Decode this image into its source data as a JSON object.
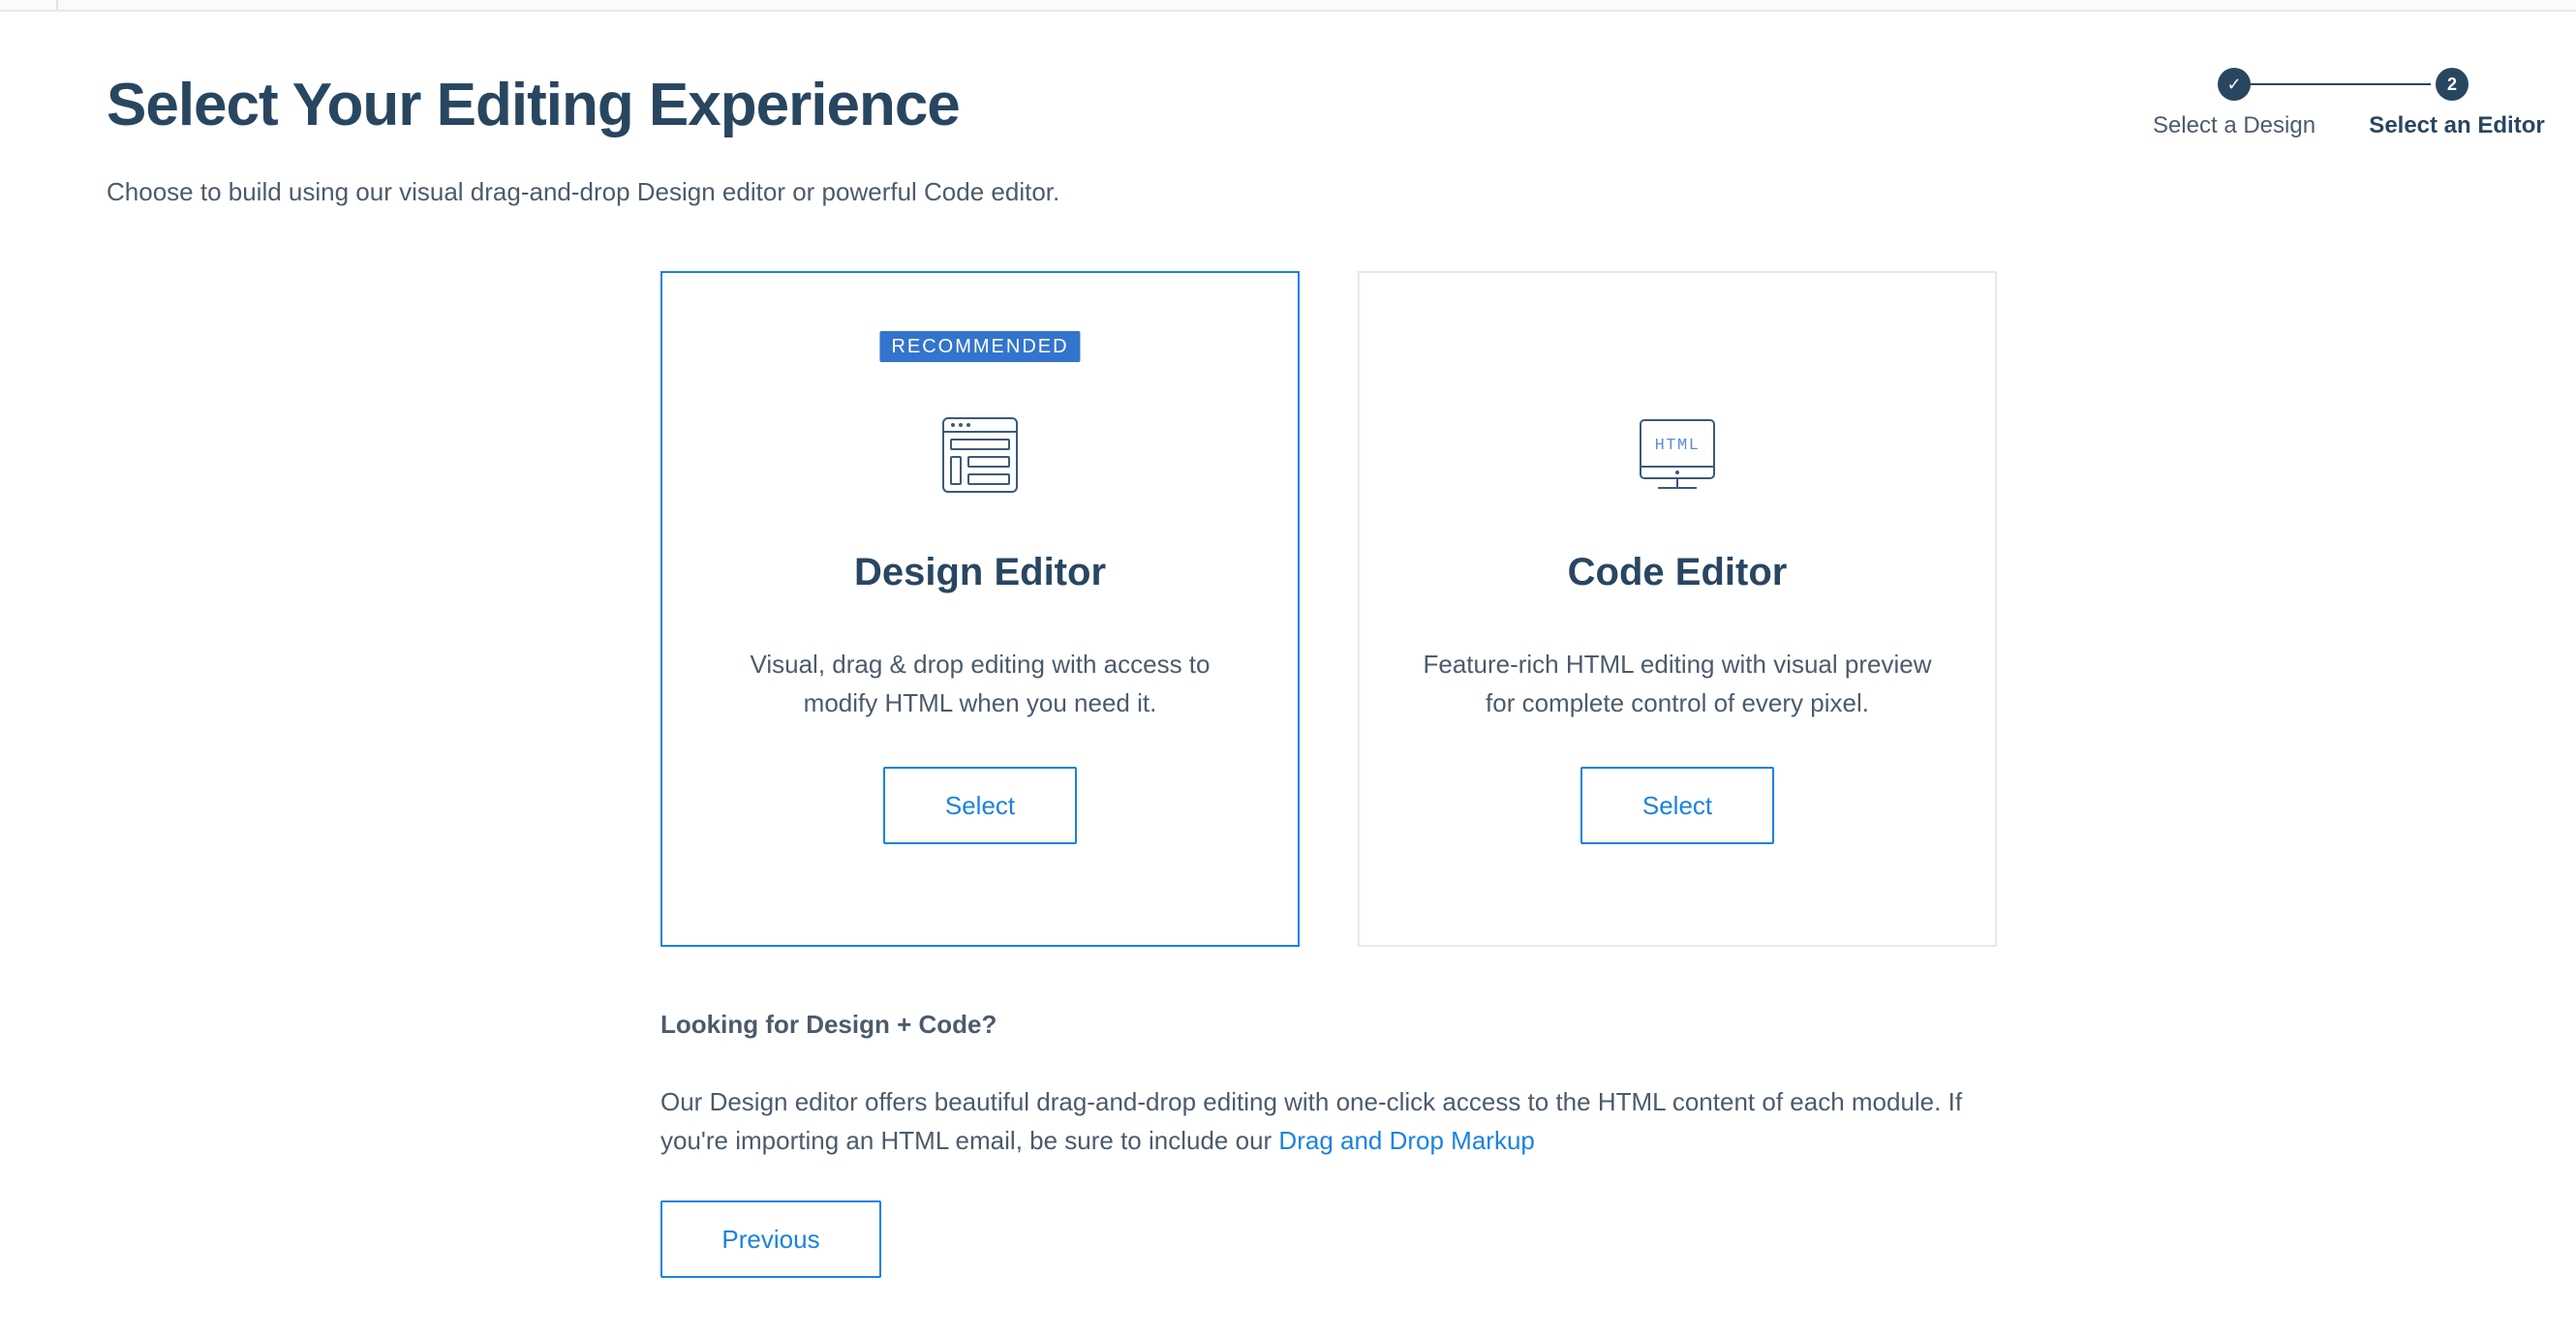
{
  "header": {
    "title": "Select Your Editing Experience",
    "subtitle": "Choose to build using our visual drag-and-drop Design editor or powerful Code editor."
  },
  "stepper": {
    "steps": [
      {
        "label": "Select a Design",
        "status": "complete",
        "marker": "✓"
      },
      {
        "label": "Select an Editor",
        "status": "current",
        "marker": "2"
      }
    ]
  },
  "cards": {
    "design": {
      "badge": "RECOMMENDED",
      "icon": "layout-template-icon",
      "title": "Design Editor",
      "description": "Visual, drag & drop editing with access to modify HTML when you need it.",
      "button_label": "Select",
      "selected": true
    },
    "code": {
      "icon": "html-monitor-icon",
      "icon_text": "HTML",
      "title": "Code Editor",
      "description": "Feature-rich HTML editing with visual preview for complete control of every pixel.",
      "button_label": "Select",
      "selected": false
    }
  },
  "info": {
    "heading": "Looking for Design + Code?",
    "text_before_link": "Our Design editor offers beautiful drag-and-drop editing with one-click access to the HTML content of each module. If you're importing an HTML email, be sure to include our ",
    "link_label": "Drag and Drop Markup"
  },
  "footer": {
    "previous_label": "Previous"
  },
  "colors": {
    "heading": "#294661",
    "body_text": "#4c5b6b",
    "accent_blue": "#1a82e2",
    "badge_blue": "#3374cc",
    "card_border": "#e6e9ec"
  }
}
